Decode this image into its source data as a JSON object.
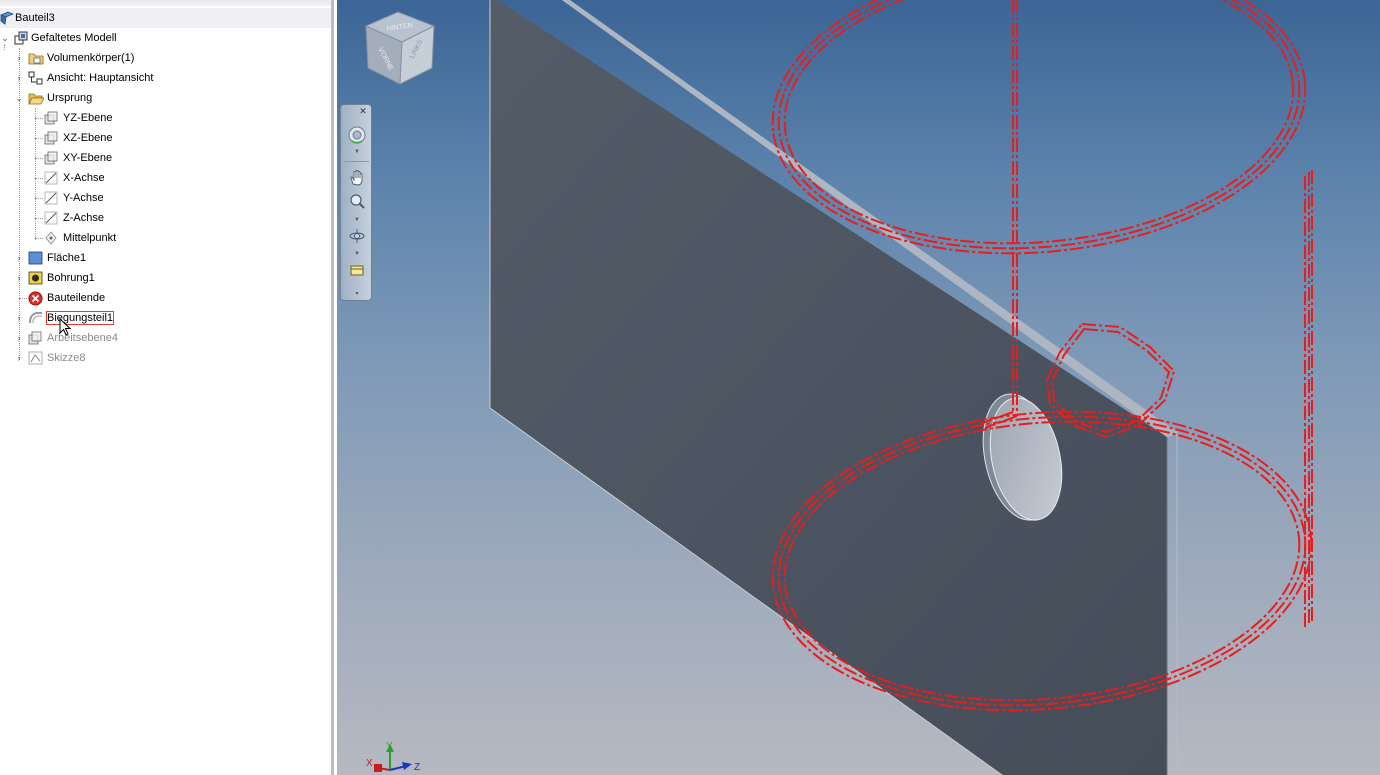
{
  "browser": {
    "root": "Bauteil3",
    "model": "Gefaltetes Modell",
    "items": [
      {
        "label": "Volumenkörper(1)",
        "icon": "folder-solid-bodies-icon",
        "expander": "›"
      },
      {
        "label": "Ansicht: Hauptansicht",
        "icon": "view-rep-icon",
        "expander": "›"
      },
      {
        "label": "Ursprung",
        "icon": "folder-open-icon",
        "expander": "⌄"
      },
      {
        "label": "YZ-Ebene",
        "icon": "work-plane-icon"
      },
      {
        "label": "XZ-Ebene",
        "icon": "work-plane-icon"
      },
      {
        "label": "XY-Ebene",
        "icon": "work-plane-icon"
      },
      {
        "label": "X-Achse",
        "icon": "work-axis-icon"
      },
      {
        "label": "Y-Achse",
        "icon": "work-axis-icon"
      },
      {
        "label": "Z-Achse",
        "icon": "work-axis-icon"
      },
      {
        "label": "Mittelpunkt",
        "icon": "work-point-icon"
      },
      {
        "label": "Fläche1",
        "icon": "face-feature-icon",
        "expander": "›"
      },
      {
        "label": "Bohrung1",
        "icon": "hole-feature-icon",
        "expander": "›"
      },
      {
        "label": "Bauteilende",
        "icon": "end-of-part-icon"
      },
      {
        "label": "Biegungsteil1",
        "icon": "bend-part-icon",
        "expander": "›"
      },
      {
        "label": "Arbeitsebene4",
        "icon": "work-plane-icon",
        "expander": "›"
      },
      {
        "label": "Skizze8",
        "icon": "sketch-icon",
        "expander": "›"
      }
    ]
  },
  "viewcube": {
    "top_label": "HINTEN",
    "left_label": "VORNE",
    "right_label": "LINKS"
  },
  "triad": {
    "x": "X",
    "y": "Y",
    "z": "Z"
  },
  "colors": {
    "preview_red": "#e81d1d",
    "plate": "#4f5866",
    "viewport_top": "#3b6595",
    "viewport_bottom": "#b6b9c1",
    "selection_outline": "#e23b3b"
  }
}
